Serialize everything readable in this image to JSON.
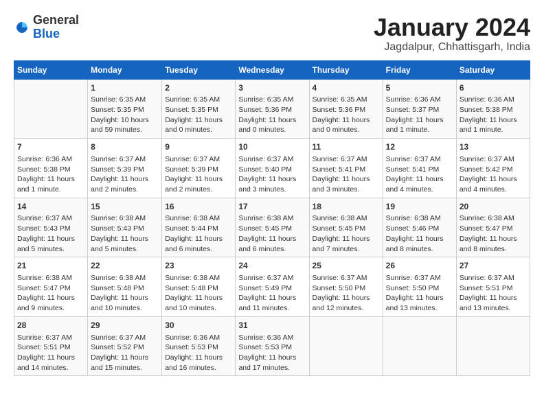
{
  "logo": {
    "general": "General",
    "blue": "Blue"
  },
  "header": {
    "title": "January 2024",
    "subtitle": "Jagdalpur, Chhattisgarh, India"
  },
  "columns": [
    "Sunday",
    "Monday",
    "Tuesday",
    "Wednesday",
    "Thursday",
    "Friday",
    "Saturday"
  ],
  "weeks": [
    [
      {
        "day": "",
        "content": ""
      },
      {
        "day": "1",
        "content": "Sunrise: 6:35 AM\nSunset: 5:35 PM\nDaylight: 10 hours\nand 59 minutes."
      },
      {
        "day": "2",
        "content": "Sunrise: 6:35 AM\nSunset: 5:35 PM\nDaylight: 11 hours\nand 0 minutes."
      },
      {
        "day": "3",
        "content": "Sunrise: 6:35 AM\nSunset: 5:36 PM\nDaylight: 11 hours\nand 0 minutes."
      },
      {
        "day": "4",
        "content": "Sunrise: 6:35 AM\nSunset: 5:36 PM\nDaylight: 11 hours\nand 0 minutes."
      },
      {
        "day": "5",
        "content": "Sunrise: 6:36 AM\nSunset: 5:37 PM\nDaylight: 11 hours\nand 1 minute."
      },
      {
        "day": "6",
        "content": "Sunrise: 6:36 AM\nSunset: 5:38 PM\nDaylight: 11 hours\nand 1 minute."
      }
    ],
    [
      {
        "day": "7",
        "content": "Sunrise: 6:36 AM\nSunset: 5:38 PM\nDaylight: 11 hours\nand 1 minute."
      },
      {
        "day": "8",
        "content": "Sunrise: 6:37 AM\nSunset: 5:39 PM\nDaylight: 11 hours\nand 2 minutes."
      },
      {
        "day": "9",
        "content": "Sunrise: 6:37 AM\nSunset: 5:39 PM\nDaylight: 11 hours\nand 2 minutes."
      },
      {
        "day": "10",
        "content": "Sunrise: 6:37 AM\nSunset: 5:40 PM\nDaylight: 11 hours\nand 3 minutes."
      },
      {
        "day": "11",
        "content": "Sunrise: 6:37 AM\nSunset: 5:41 PM\nDaylight: 11 hours\nand 3 minutes."
      },
      {
        "day": "12",
        "content": "Sunrise: 6:37 AM\nSunset: 5:41 PM\nDaylight: 11 hours\nand 4 minutes."
      },
      {
        "day": "13",
        "content": "Sunrise: 6:37 AM\nSunset: 5:42 PM\nDaylight: 11 hours\nand 4 minutes."
      }
    ],
    [
      {
        "day": "14",
        "content": "Sunrise: 6:37 AM\nSunset: 5:43 PM\nDaylight: 11 hours\nand 5 minutes."
      },
      {
        "day": "15",
        "content": "Sunrise: 6:38 AM\nSunset: 5:43 PM\nDaylight: 11 hours\nand 5 minutes."
      },
      {
        "day": "16",
        "content": "Sunrise: 6:38 AM\nSunset: 5:44 PM\nDaylight: 11 hours\nand 6 minutes."
      },
      {
        "day": "17",
        "content": "Sunrise: 6:38 AM\nSunset: 5:45 PM\nDaylight: 11 hours\nand 6 minutes."
      },
      {
        "day": "18",
        "content": "Sunrise: 6:38 AM\nSunset: 5:45 PM\nDaylight: 11 hours\nand 7 minutes."
      },
      {
        "day": "19",
        "content": "Sunrise: 6:38 AM\nSunset: 5:46 PM\nDaylight: 11 hours\nand 8 minutes."
      },
      {
        "day": "20",
        "content": "Sunrise: 6:38 AM\nSunset: 5:47 PM\nDaylight: 11 hours\nand 8 minutes."
      }
    ],
    [
      {
        "day": "21",
        "content": "Sunrise: 6:38 AM\nSunset: 5:47 PM\nDaylight: 11 hours\nand 9 minutes."
      },
      {
        "day": "22",
        "content": "Sunrise: 6:38 AM\nSunset: 5:48 PM\nDaylight: 11 hours\nand 10 minutes."
      },
      {
        "day": "23",
        "content": "Sunrise: 6:38 AM\nSunset: 5:48 PM\nDaylight: 11 hours\nand 10 minutes."
      },
      {
        "day": "24",
        "content": "Sunrise: 6:37 AM\nSunset: 5:49 PM\nDaylight: 11 hours\nand 11 minutes."
      },
      {
        "day": "25",
        "content": "Sunrise: 6:37 AM\nSunset: 5:50 PM\nDaylight: 11 hours\nand 12 minutes."
      },
      {
        "day": "26",
        "content": "Sunrise: 6:37 AM\nSunset: 5:50 PM\nDaylight: 11 hours\nand 13 minutes."
      },
      {
        "day": "27",
        "content": "Sunrise: 6:37 AM\nSunset: 5:51 PM\nDaylight: 11 hours\nand 13 minutes."
      }
    ],
    [
      {
        "day": "28",
        "content": "Sunrise: 6:37 AM\nSunset: 5:51 PM\nDaylight: 11 hours\nand 14 minutes."
      },
      {
        "day": "29",
        "content": "Sunrise: 6:37 AM\nSunset: 5:52 PM\nDaylight: 11 hours\nand 15 minutes."
      },
      {
        "day": "30",
        "content": "Sunrise: 6:36 AM\nSunset: 5:53 PM\nDaylight: 11 hours\nand 16 minutes."
      },
      {
        "day": "31",
        "content": "Sunrise: 6:36 AM\nSunset: 5:53 PM\nDaylight: 11 hours\nand 17 minutes."
      },
      {
        "day": "",
        "content": ""
      },
      {
        "day": "",
        "content": ""
      },
      {
        "day": "",
        "content": ""
      }
    ]
  ]
}
